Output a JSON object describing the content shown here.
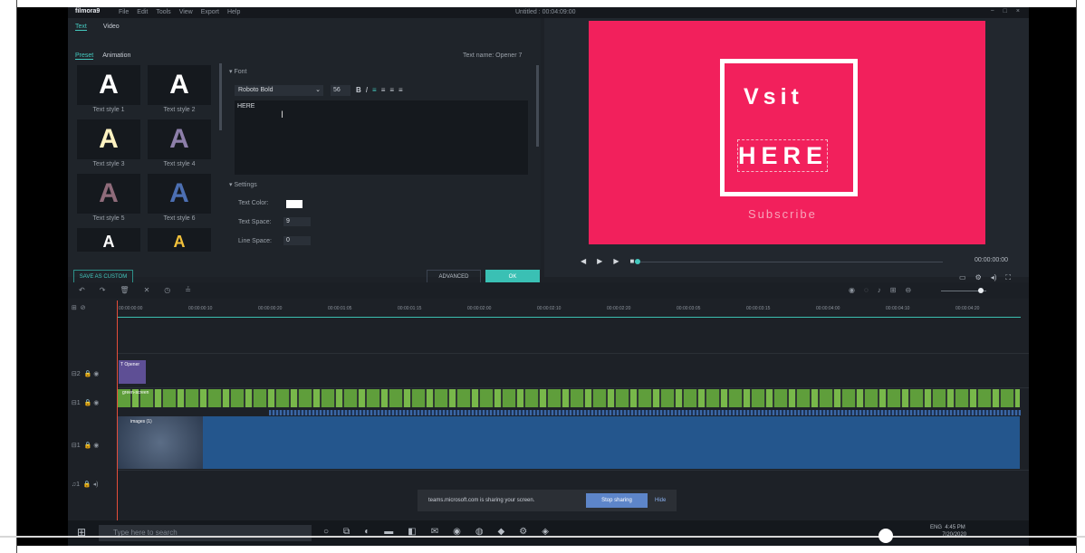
{
  "window": {
    "app_name": "filmora9",
    "menu": [
      "File",
      "Edit",
      "Tools",
      "View",
      "Export",
      "Help"
    ],
    "doc_title": "Untitled : 00:04:09:00",
    "controls": [
      "−",
      "□",
      "×"
    ]
  },
  "editor": {
    "tabs": [
      "Text",
      "Video"
    ],
    "subtabs": [
      "Preset",
      "Animation"
    ],
    "text_name": "Text name: Opener 7",
    "styles": [
      {
        "label": "Text style 1",
        "glyph": "A",
        "color": "#ffffff"
      },
      {
        "label": "Text style 2",
        "glyph": "A",
        "color": "#ffffff"
      },
      {
        "label": "Text style 3",
        "glyph": "A",
        "color": "#fff3c2"
      },
      {
        "label": "Text style 4",
        "glyph": "A",
        "color": "#8d7faa"
      },
      {
        "label": "Text style 5",
        "glyph": "A",
        "color": "#8f6b7a"
      },
      {
        "label": "Text style 6",
        "glyph": "A",
        "color": "#4c6fb2"
      },
      {
        "label": "",
        "glyph": "A",
        "color": "#ffffff"
      },
      {
        "label": "",
        "glyph": "A",
        "color": "#f2c13b"
      }
    ],
    "save_custom": "SAVE AS CUSTOM",
    "font_section": "Font",
    "font_value": "Roboto Bold",
    "size_value": "56",
    "text_value": "HERE",
    "settings_section": "Settings",
    "text_color_label": "Text Color:",
    "text_space_label": "Text Space:",
    "text_space_value": "9",
    "line_space_label": "Line Space:",
    "line_space_value": "0",
    "advanced": "ADVANCED",
    "ok": "OK"
  },
  "preview": {
    "line1": "Vsit",
    "line2": "HERE",
    "line3": "Subscribe",
    "timecode": "00:00:00:00"
  },
  "timeline": {
    "ticks": [
      "00:00:00:00",
      "00:00:00:10",
      "00:00:00:20",
      "00:00:01:05",
      "00:00:01:15",
      "00:00:02:00",
      "00:00:02:10",
      "00:00:02:20",
      "00:00:03:05",
      "00:00:03:15",
      "00:00:04:00",
      "00:00:04:10",
      "00:00:04:20"
    ],
    "text_clip": "Opener",
    "video_clip": "green-screen",
    "image_clip": "images (1)",
    "track_ids": [
      "2",
      "1",
      "1",
      "1"
    ]
  },
  "share": {
    "message": "teams.microsoft.com is sharing your screen.",
    "stop": "Stop sharing",
    "hide": "Hide"
  },
  "taskbar": {
    "search": "Type here to search",
    "lang": "ENG",
    "time": "4:45 PM",
    "date": "7/20/2020"
  }
}
